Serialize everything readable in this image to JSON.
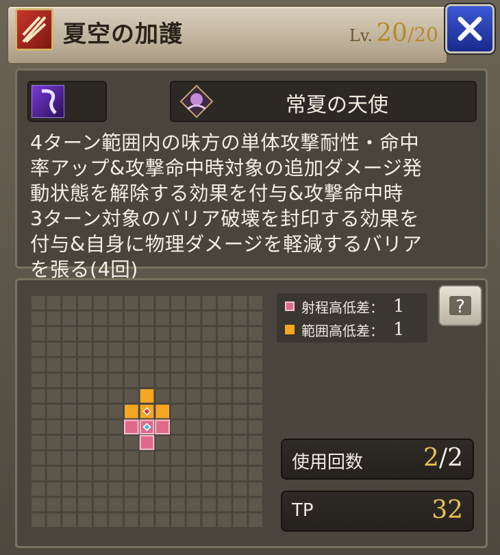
{
  "header": {
    "title": "夏空の加護",
    "level_label": "Lv.",
    "level_current": "20",
    "level_max": "/20",
    "close_icon": "close-icon"
  },
  "skill": {
    "element_icon": "dark-element-icon",
    "buff_icon": "angel-buff-icon",
    "buff_name": "常夏の天使",
    "description": "4ターン範囲内の味方の単体攻撃耐性・命中\n率アップ&攻撃命中時対象の追加ダメージ発\n動状態を解除する効果を付与&攻撃命中時\n3ターン対象のバリア破壊を封印する効果を\n付与&自身に物理ダメージを軽減するバリア\nを張る(4回)"
  },
  "range_info": {
    "range_label": "射程高低差：",
    "range_value": "1",
    "area_label": "範囲高低差：",
    "area_value": "1",
    "help_icon": "help-icon"
  },
  "stats": {
    "uses_label": "使用回数",
    "uses_current": "2",
    "uses_sep_max": "/2",
    "tp_label": "TP",
    "tp_value": "32"
  },
  "colors": {
    "range": "#e06a8a",
    "area": "#f5a623",
    "center": "#35c3e8",
    "cell": "#5d574c"
  },
  "grid": {
    "size": 15,
    "area_cells": [
      [
        7,
        6
      ],
      [
        6,
        7
      ],
      [
        8,
        7
      ]
    ],
    "range_cells": [
      [
        6,
        8
      ],
      [
        8,
        8
      ],
      [
        7,
        9
      ]
    ],
    "target_cell": [
      7,
      7
    ],
    "center_cell": [
      7,
      8
    ]
  }
}
